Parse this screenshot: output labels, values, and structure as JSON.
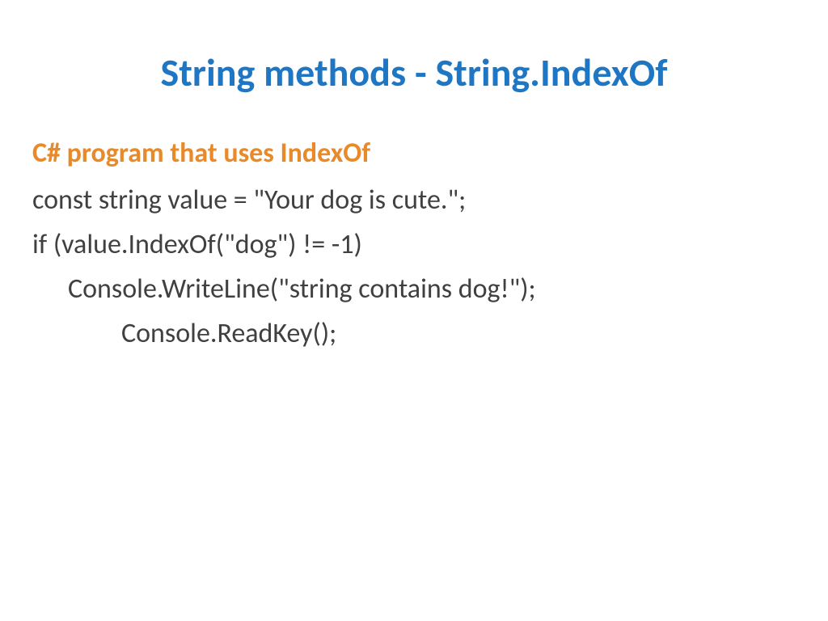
{
  "title": "String methods - String.IndexOf",
  "subtitle": "C# program that uses IndexOf",
  "code": {
    "line1": "const string value = \"Your dog is cute.\";",
    "line2": "if (value.IndexOf(\"dog\") != -1)",
    "line3": "Console.WriteLine(\"string contains dog!\");",
    "line4": "Console.ReadKey();"
  }
}
